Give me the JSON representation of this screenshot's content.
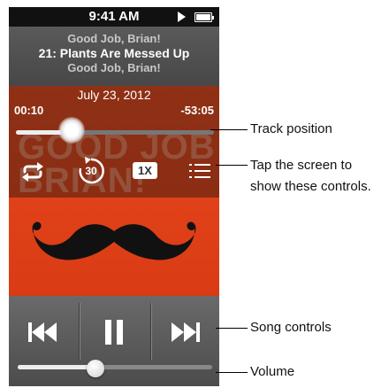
{
  "status_bar": {
    "time": "9:41 AM",
    "play_icon": "play-icon",
    "battery_icon": "battery-icon"
  },
  "track": {
    "artist": "Good Job, Brian!",
    "song": "21: Plants Are Messed Up",
    "album": "Good Job, Brian!"
  },
  "overlay": {
    "date": "July 23, 2012",
    "elapsed": "00:10",
    "remaining": "-53:05",
    "position_fraction": 0.28,
    "skip_label": "30",
    "speed_label": "1X"
  },
  "art": {
    "title": "GOOD JOB BRIAN!",
    "background": "#e0441a"
  },
  "volume": {
    "level_fraction": 0.4
  },
  "callouts": {
    "track_position": "Track position",
    "tap_screen_line1": "Tap the screen to",
    "tap_screen_line2": "show these controls.",
    "song_controls": "Song controls",
    "volume": "Volume"
  }
}
